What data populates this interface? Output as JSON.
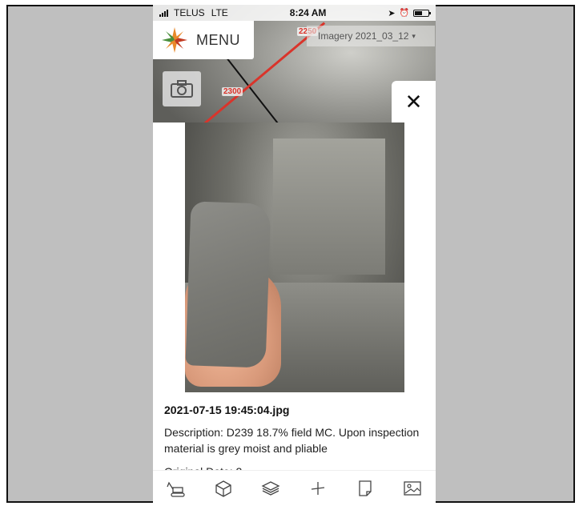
{
  "status_bar": {
    "carrier": "TELUS",
    "network": "LTE",
    "time": "8:24 AM"
  },
  "map": {
    "menu_label": "MENU",
    "imagery_label": "Imagery 2021_03_12",
    "stations": [
      "2250",
      "2300"
    ]
  },
  "photo_detail": {
    "file_name": "2021-07-15 19:45:04.jpg",
    "description": "Description: D239 18.7% field MC. Upon inspection material is grey moist and pliable",
    "original_date": "Original Date: 2"
  },
  "toolbar": {
    "icons": [
      "excavator-icon",
      "cube-icon",
      "layers-icon",
      "plus-icon",
      "page-icon",
      "image-icon"
    ]
  },
  "colors": {
    "accent_red": "#d9342b",
    "logo_orange": "#e8892b",
    "logo_green": "#4a8f3c",
    "logo_red": "#c23b22"
  }
}
